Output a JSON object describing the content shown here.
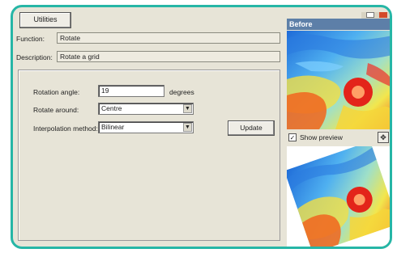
{
  "toolbar": {
    "utilities_label": "Utilities"
  },
  "fields": {
    "function_label": "Function:",
    "function_value": "Rotate",
    "description_label": "Description:",
    "description_value": "Rotate a grid"
  },
  "params": {
    "rotation_angle_label": "Rotation angle:",
    "rotation_angle_value": "19",
    "rotation_angle_unit": "degrees",
    "rotate_around_label": "Rotate around:",
    "rotate_around_value": "Centre",
    "interpolation_label": "Interpolation method:",
    "interpolation_value": "Bilinear",
    "update_label": "Update"
  },
  "preview": {
    "before_title": "Before",
    "show_preview_label": "Show preview",
    "show_preview_checked": "✓"
  },
  "colors": {
    "frame_border": "#26b6a6",
    "panel_bg": "#e7e4d7",
    "header_bg": "#5d7fa8"
  }
}
